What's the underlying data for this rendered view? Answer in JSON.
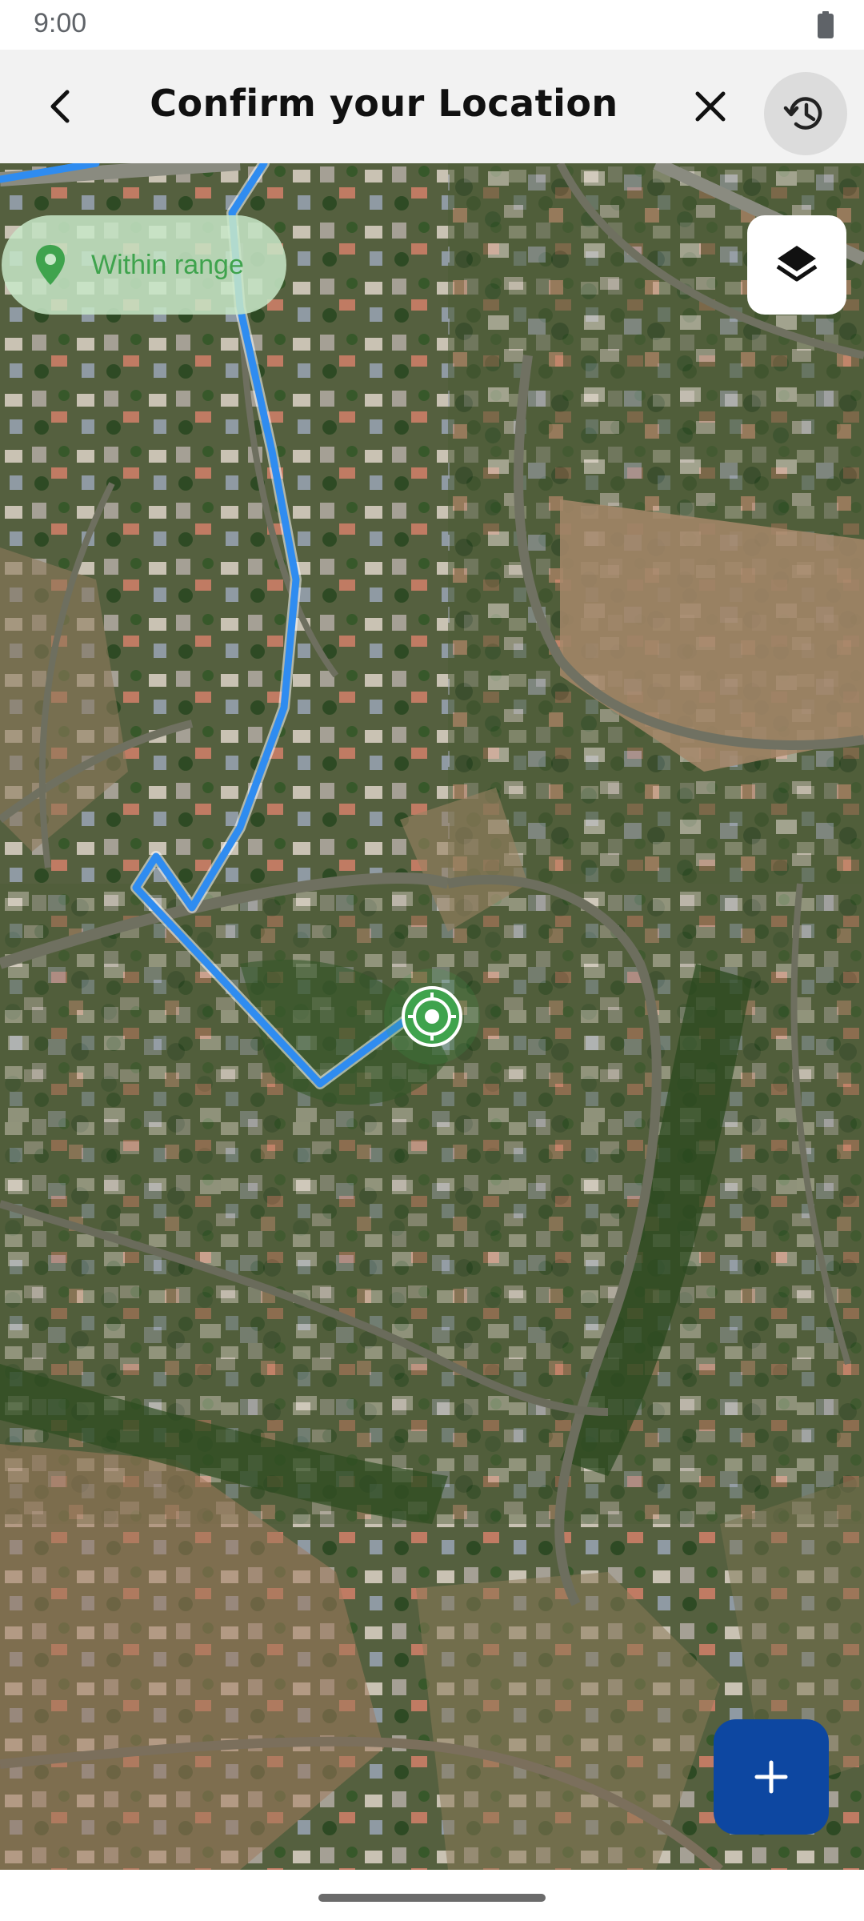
{
  "status_bar": {
    "time": "9:00",
    "battery_icon": "battery-icon"
  },
  "header": {
    "title": "Confirm your Location",
    "back_icon": "chevron-left-icon",
    "close_icon": "close-icon",
    "history_icon": "history-icon"
  },
  "map": {
    "range_status": "Within range",
    "range_status_color": "#3fa34d",
    "route_color": "#2f8cf0",
    "location_marker_color": "#3fa34d",
    "layers_icon": "layers-icon",
    "add_icon": "plus-icon",
    "add_button_color": "#0d47a1"
  }
}
